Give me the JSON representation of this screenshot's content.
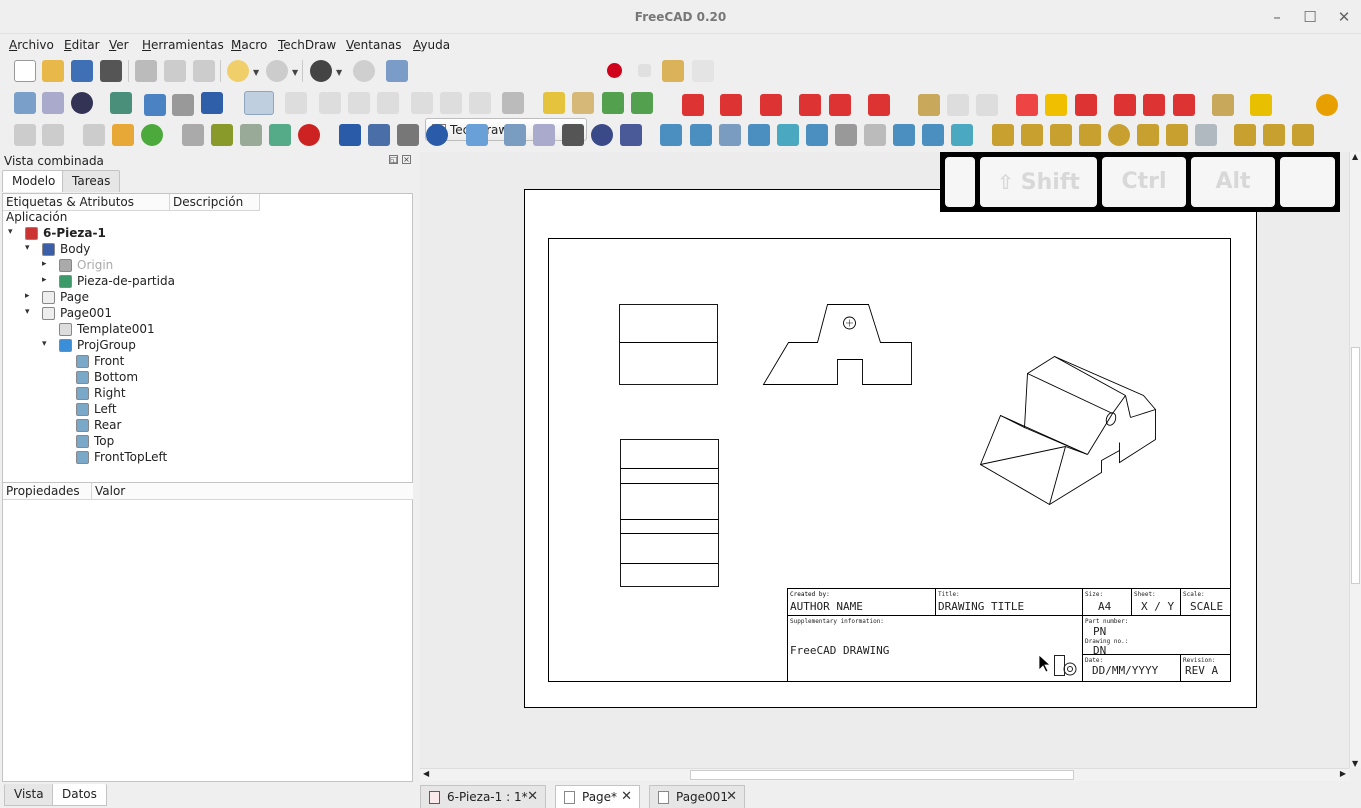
{
  "window": {
    "title": "FreeCAD 0.20",
    "minimize": "–",
    "maximize": "☐",
    "close": "✕"
  },
  "menu": [
    "Archivo",
    "Editar",
    "Ver",
    "Herramientas",
    "Macro",
    "TechDraw",
    "Ventanas",
    "Ayuda"
  ],
  "workbench": {
    "selected": "TechDraw"
  },
  "combo": {
    "title": "Vista combinada",
    "tabs": [
      "Modelo",
      "Tareas"
    ],
    "columns": [
      "Etiquetas & Atributos",
      "Descripción"
    ],
    "root": "Aplicación",
    "items": [
      {
        "label": "6-Pieza-1",
        "level": 0,
        "arrow": "▾",
        "icon": "document-icon",
        "bold": true
      },
      {
        "label": "Body",
        "level": 1,
        "arrow": "▾",
        "icon": "body-icon"
      },
      {
        "label": "Origin",
        "level": 2,
        "arrow": "▸",
        "icon": "origin-icon",
        "muted": true
      },
      {
        "label": "Pieza-de-partida",
        "level": 2,
        "arrow": "▸",
        "icon": "feature-icon"
      },
      {
        "label": "Page",
        "level": 1,
        "arrow": "▸",
        "icon": "page-icon"
      },
      {
        "label": "Page001",
        "level": 1,
        "arrow": "▾",
        "icon": "page-icon"
      },
      {
        "label": "Template001",
        "level": 2,
        "arrow": "",
        "icon": "template-icon"
      },
      {
        "label": "ProjGroup",
        "level": 2,
        "arrow": "▾",
        "icon": "projgroup-icon"
      },
      {
        "label": "Front",
        "level": 3,
        "arrow": "",
        "icon": "view-icon"
      },
      {
        "label": "Bottom",
        "level": 3,
        "arrow": "",
        "icon": "view-icon"
      },
      {
        "label": "Right",
        "level": 3,
        "arrow": "",
        "icon": "view-icon"
      },
      {
        "label": "Left",
        "level": 3,
        "arrow": "",
        "icon": "view-icon"
      },
      {
        "label": "Rear",
        "level": 3,
        "arrow": "",
        "icon": "view-icon"
      },
      {
        "label": "Top",
        "level": 3,
        "arrow": "",
        "icon": "view-icon"
      },
      {
        "label": "FrontTopLeft",
        "level": 3,
        "arrow": "",
        "icon": "view-icon"
      }
    ]
  },
  "properties": {
    "columns": [
      "Propiedades",
      "Valor"
    ],
    "tabs": [
      "Vista",
      "Datos"
    ]
  },
  "titleblock": {
    "created_by_lbl": "Created by:",
    "author": "AUTHOR NAME",
    "title_lbl": "Title:",
    "title": "DRAWING TITLE",
    "size_lbl": "Size:",
    "size": "A4",
    "sheet_lbl": "Sheet:",
    "sheet": "X / Y",
    "scale_lbl": "Scale:",
    "scale": "SCALE",
    "supp_lbl": "Supplementary information:",
    "supp": "FreeCAD DRAWING",
    "part_lbl": "Part number:",
    "part": "PN",
    "drawing_lbl": "Drawing no.:",
    "drawing": "DN",
    "date_lbl": "Date:",
    "date": "DD/MM/YYYY",
    "rev_lbl": "Revision:",
    "rev": "REV A"
  },
  "keys": {
    "shift": "Shift",
    "ctrl": "Ctrl",
    "alt": "Alt"
  },
  "doc_tabs": [
    {
      "label": "6-Pieza-1 : 1*",
      "close": "✕"
    },
    {
      "label": "Page*",
      "close": "✕"
    },
    {
      "label": "Page001",
      "close": "✕"
    }
  ],
  "colors": {
    "accent": "#1b66c9",
    "record": "#d0021b"
  }
}
